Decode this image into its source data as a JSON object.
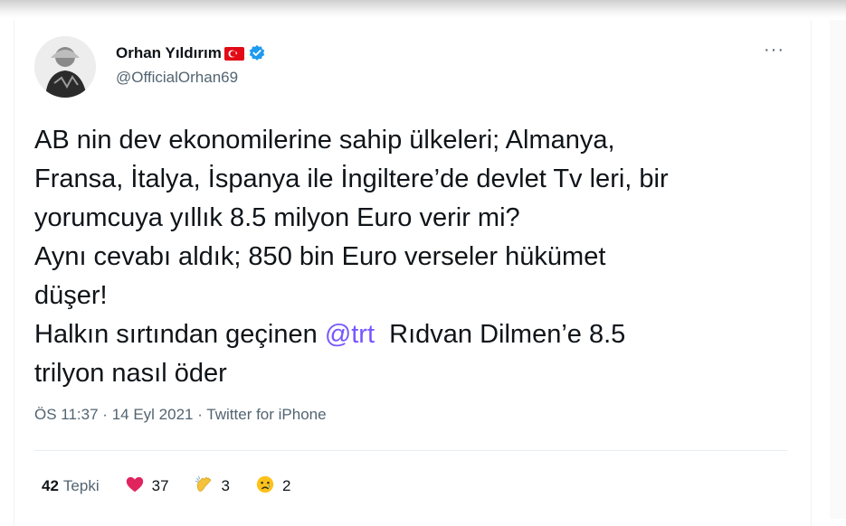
{
  "author": {
    "name": "Orhan Yıldırım",
    "handle": "@OfficialOrhan69",
    "flag_icon": "turkey-flag-icon",
    "verified_icon": "verified-badge-icon"
  },
  "tweet": {
    "text_parts": [
      "AB nin dev ekonomilerine sahip ülkeleri; Almanya,\nFransa, İtalya, İspanya ile İngiltere’de devlet Tv leri, bir\nyorumcuya yıllık 8.5 milyon Euro verir mi?\nAynı cevabı aldık; 850 bin Euro verseler hükümet\ndüşer!\nHalkın sırtından geçinen ",
      "@trt",
      "  Rıdvan Dilmen’e 8.5\ntrilyon nasıl öder"
    ]
  },
  "meta": {
    "time": "ÖS 11:37",
    "sep1": " · ",
    "date": "14 Eyl 2021",
    "sep2": " · ",
    "source": "Twitter for iPhone"
  },
  "stats": {
    "total_count": "42",
    "total_label": "Tepki",
    "reactions": [
      {
        "icon": "red-heart-icon",
        "count": "37"
      },
      {
        "icon": "clapping-hands-icon",
        "count": "3"
      },
      {
        "icon": "crying-face-icon",
        "count": "2"
      }
    ]
  },
  "more_label": "···",
  "colors": {
    "text": "#0f1419",
    "secondary": "#536471",
    "mention": "#7856ff",
    "verified": "#1d9bf0"
  }
}
